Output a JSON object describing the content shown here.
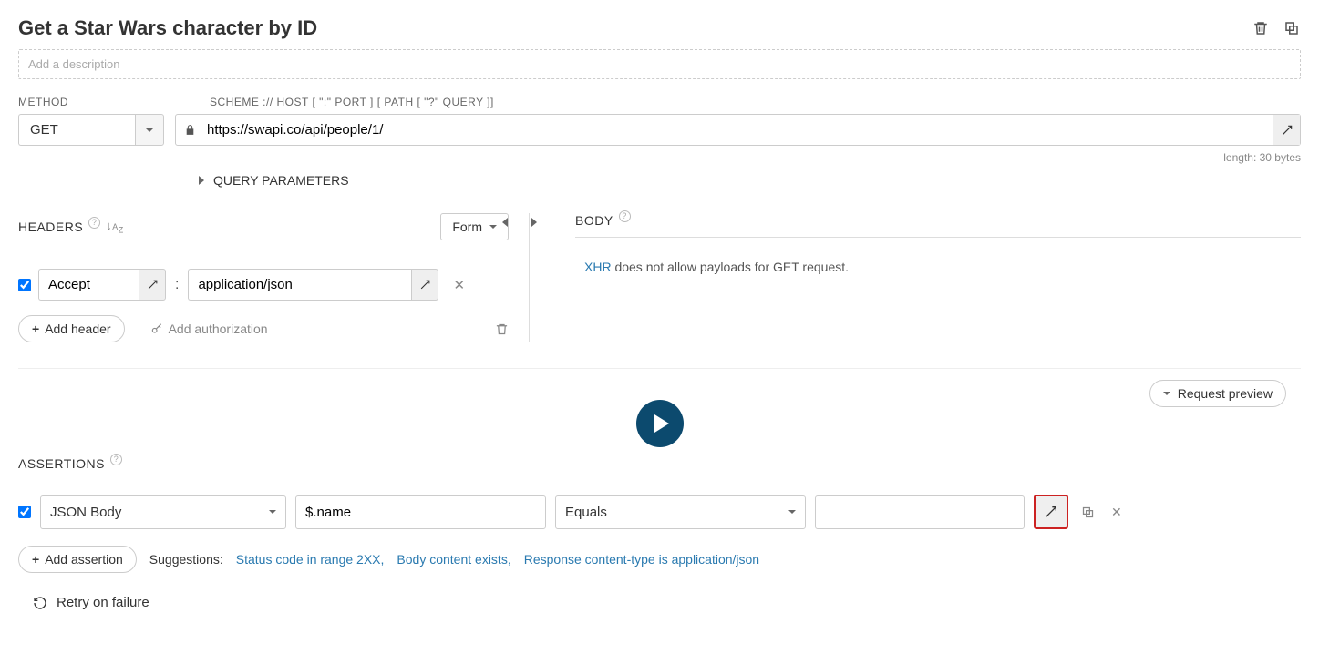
{
  "title": "Get a Star Wars character by ID",
  "description_placeholder": "Add a description",
  "method": {
    "label": "METHOD",
    "value": "GET"
  },
  "url": {
    "label": "SCHEME :// HOST [ \":\" PORT ] [ PATH [ \"?\" QUERY ]]",
    "value": "https://swapi.co/api/people/1/",
    "length_text": "length: 30 bytes"
  },
  "query_params_label": "QUERY PARAMETERS",
  "headers": {
    "title": "HEADERS",
    "form_toggle": "Form",
    "rows": [
      {
        "name": "Accept",
        "value": "application/json"
      }
    ],
    "add_header": "Add header",
    "add_auth": "Add authorization"
  },
  "body": {
    "title": "BODY",
    "xhr": "XHR",
    "msg_rest": " does not allow payloads for GET request."
  },
  "preview_label": "Request preview",
  "assertions": {
    "title": "ASSERTIONS",
    "rows": [
      {
        "source": "JSON Body",
        "property": "$.name",
        "comparison": "Equals",
        "value": ""
      }
    ],
    "add_assertion": "Add assertion",
    "retry": "Retry on failure"
  },
  "suggestions": {
    "label": "Suggestions:",
    "items": [
      "Status code in range 2XX",
      "Body content exists",
      "Response content-type is application/json"
    ]
  }
}
